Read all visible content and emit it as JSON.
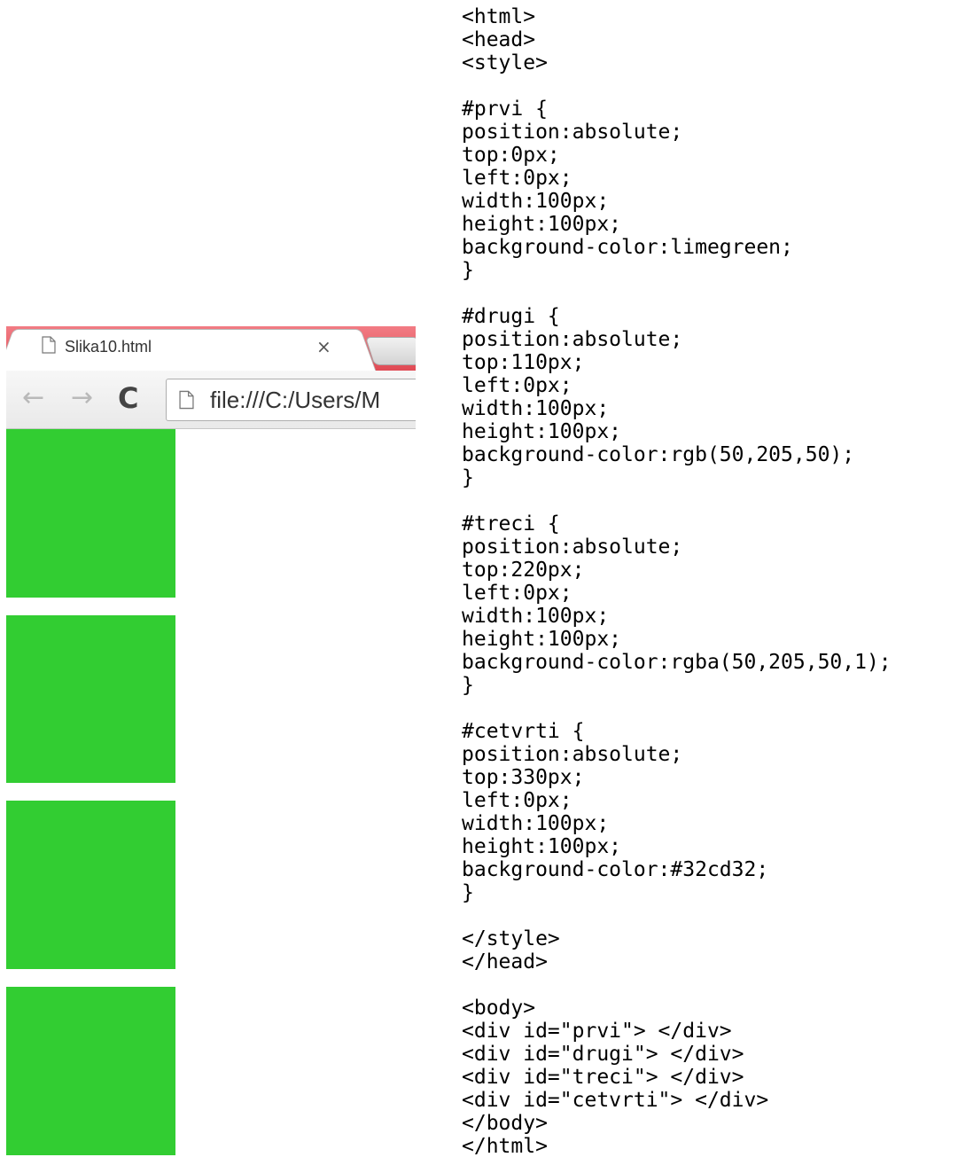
{
  "browser": {
    "tab": {
      "title": "Slika10.html",
      "close_label": "×",
      "page_icon": "page-icon"
    },
    "toolbar": {
      "back_label": "←",
      "forward_label": "→",
      "reload_label": "C",
      "url": "file:///C:/Users/M"
    },
    "boxes": [
      {
        "id": "prvi",
        "color": "#32cd32"
      },
      {
        "id": "drugi",
        "color": "#32cd32"
      },
      {
        "id": "treci",
        "color": "#32cd32"
      },
      {
        "id": "cetvrti",
        "color": "#32cd32"
      }
    ]
  },
  "code": {
    "lines": [
      "<html>",
      "<head>",
      "<style>",
      "",
      "#prvi {",
      "position:absolute;",
      "top:0px;",
      "left:0px;",
      "width:100px;",
      "height:100px;",
      "background-color:limegreen;",
      "}",
      "",
      "#drugi {",
      "position:absolute;",
      "top:110px;",
      "left:0px;",
      "width:100px;",
      "height:100px;",
      "background-color:rgb(50,205,50);",
      "}",
      "",
      "#treci {",
      "position:absolute;",
      "top:220px;",
      "left:0px;",
      "width:100px;",
      "height:100px;",
      "background-color:rgba(50,205,50,1);",
      "}",
      "",
      "#cetvrti {",
      "position:absolute;",
      "top:330px;",
      "left:0px;",
      "width:100px;",
      "height:100px;",
      "background-color:#32cd32;",
      "}",
      "",
      "</style>",
      "</head>",
      "",
      "<body>",
      "<div id=\"prvi\"> </div>",
      "<div id=\"drugi\"> </div>",
      "<div id=\"treci\"> </div>",
      "<div id=\"cetvrti\"> </div>",
      "</body>",
      "</html>"
    ]
  }
}
